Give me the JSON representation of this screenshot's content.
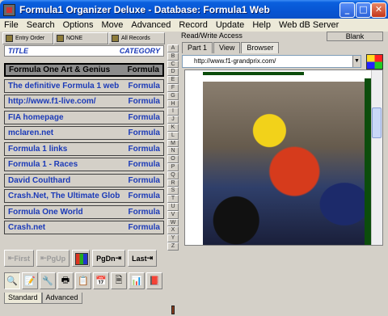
{
  "window": {
    "title": "Formula1 Organizer Deluxe - Database: Formula1 Web"
  },
  "menu": [
    "File",
    "Search",
    "Options",
    "Move",
    "Advanced",
    "Record",
    "Update",
    "Help",
    "Web dB Server"
  ],
  "toolbar_top": {
    "entry_order": "Entry Order",
    "none": "NONE",
    "all_records": "All Records"
  },
  "list_header": {
    "title": "TITLE",
    "category": "CATEGORY"
  },
  "records": [
    {
      "title": "Formula One Art & Genius",
      "category": "Formula"
    },
    {
      "title": "The definitive Formula 1 web",
      "category": "Formula"
    },
    {
      "title": "http://www.f1-live.com/",
      "category": "Formula"
    },
    {
      "title": "FIA homepage",
      "category": "Formula"
    },
    {
      "title": "mclaren.net",
      "category": "Formula"
    },
    {
      "title": "Formula 1 links",
      "category": "Formula"
    },
    {
      "title": "Formula 1 - Races",
      "category": "Formula"
    },
    {
      "title": "David Coulthard",
      "category": "Formula"
    },
    {
      "title": "Crash.Net, The Ultimate Glob",
      "category": "Formula"
    },
    {
      "title": "Formula One World",
      "category": "Formula"
    },
    {
      "title": "Crash.net",
      "category": "Formula"
    }
  ],
  "alphabet": [
    "A",
    "B",
    "C",
    "D",
    "E",
    "F",
    "G",
    "H",
    "I",
    "J",
    "K",
    "L",
    "M",
    "N",
    "O",
    "P",
    "Q",
    "R",
    "S",
    "T",
    "U",
    "V",
    "W",
    "X",
    "Y",
    "Z"
  ],
  "nav": {
    "first": "First",
    "pgup": "PgUp",
    "pgdn": "PgDn",
    "last": "Last"
  },
  "status": {
    "mode": "Read/Write Access",
    "blank": "Blank"
  },
  "tabs": [
    "Part 1",
    "View",
    "Browser"
  ],
  "url": {
    "check": "✓",
    "value": "http://www.f1-grandprix.com/"
  },
  "bottom_icons": [
    "🔍",
    "📝",
    "🔧",
    "🖶",
    "📋",
    "📅",
    "🗎",
    "📊",
    "📕"
  ],
  "mode_tabs": [
    "Standard",
    "Advanced"
  ]
}
